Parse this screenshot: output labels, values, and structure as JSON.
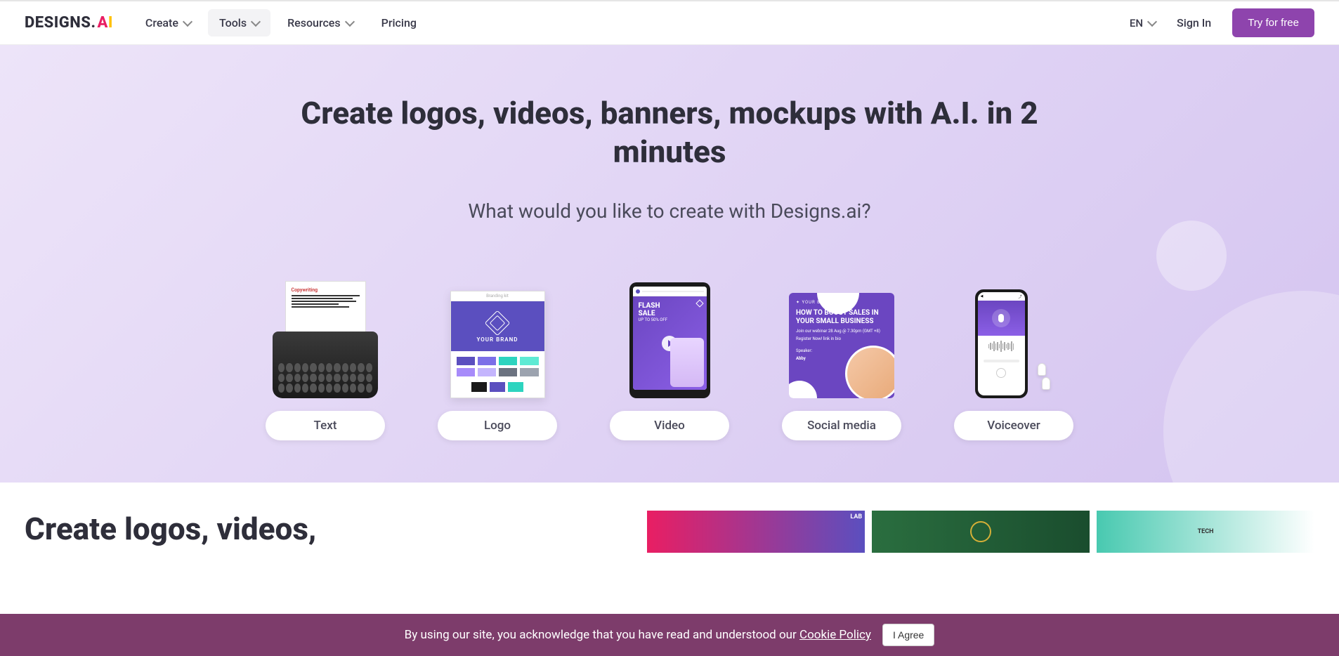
{
  "header": {
    "logo_text": "DESIGNS.",
    "logo_a": "A",
    "logo_i": "I",
    "nav": {
      "create": "Create",
      "tools": "Tools",
      "resources": "Resources",
      "pricing": "Pricing"
    },
    "lang": "EN",
    "signin": "Sign In",
    "try": "Try for free"
  },
  "hero": {
    "title": "Create logos, videos, banners, mockups with A.I. in 2 minutes",
    "subtitle": "What would you like to create with Designs.ai?",
    "cards": {
      "text": "Text",
      "logo": "Logo",
      "video": "Video",
      "social": "Social media",
      "voiceover": "Voiceover"
    },
    "typewriter": {
      "paper_title": "Copywriting"
    },
    "logo_card": {
      "header": "Branding kit",
      "brand_text": "YOUR BRAND"
    },
    "video_card": {
      "flash": "FLASH",
      "sale": "SALE",
      "sub": "UP TO 50% OFF"
    },
    "social_card": {
      "brand": "✦ YOUR BRAND",
      "title": "HOW TO BOOST SALES IN YOUR SMALL BUSINESS",
      "sub1": "Join our webinar 28 Aug @ 7.30pm (GMT +8)",
      "sub2": "Register Now! link in bio",
      "speaker": "Speaker:",
      "name": "Abby"
    }
  },
  "section2": {
    "title": "Create logos, videos,",
    "badge1": "LAB",
    "badge2": "TECH"
  },
  "cookie": {
    "text_before": "By using our site, you acknowledge that you have read and understood our ",
    "link": "Cookie Policy",
    "agree": "I Agree"
  }
}
